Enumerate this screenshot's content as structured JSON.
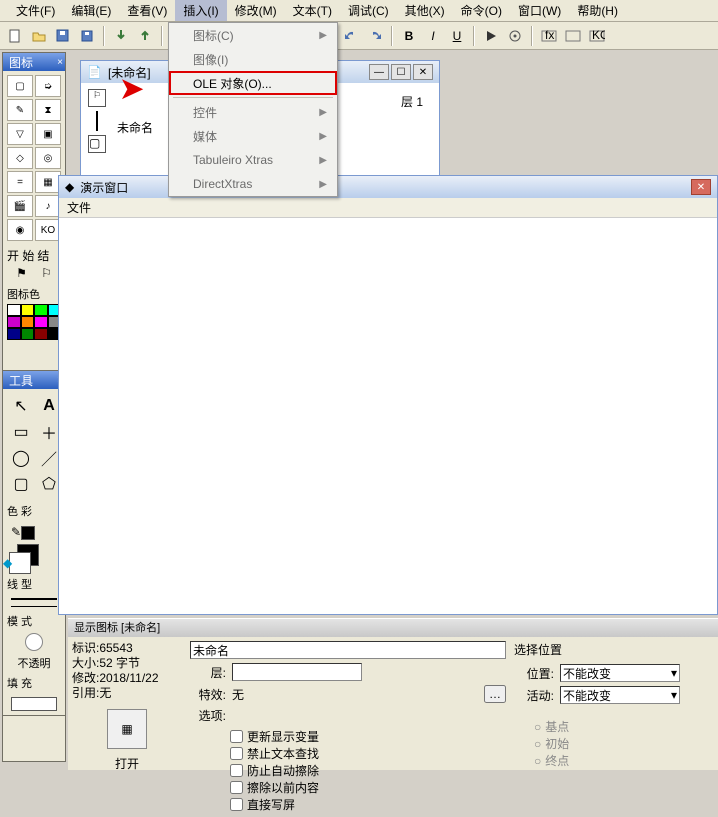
{
  "menu": [
    "文件(F)",
    "编辑(E)",
    "查看(V)",
    "插入(I)",
    "修改(M)",
    "文本(T)",
    "调试(C)",
    "其他(X)",
    "命令(O)",
    "窗口(W)",
    "帮助(H)"
  ],
  "menu_active_index": 3,
  "dropdown": {
    "items": [
      {
        "label": "图标(C)",
        "arrow": true,
        "enabled": false
      },
      {
        "label": "图像(I)",
        "arrow": false,
        "enabled": false
      },
      {
        "label": "OLE 对象(O)...",
        "arrow": false,
        "enabled": true,
        "highlight": true
      },
      {
        "sep": true
      },
      {
        "label": "控件",
        "arrow": true,
        "enabled": false
      },
      {
        "label": "媒体",
        "arrow": true,
        "enabled": false
      },
      {
        "label": "Tabuleiro Xtras",
        "arrow": true,
        "enabled": false
      },
      {
        "label": "DirectXtras",
        "arrow": true,
        "enabled": false
      }
    ]
  },
  "iconpanel_title": "图标",
  "iconpanel_sections": {
    "start": "开 始",
    "end": "结",
    "colors": "图标色"
  },
  "toolpanel_title": "工具",
  "toolpanel_sections": {
    "color": "色 彩",
    "line": "线 型",
    "mode": "模 式",
    "trans": "不透明",
    "fill": "填 充"
  },
  "flowwin": {
    "title": "[未命名]",
    "node": "未命名",
    "layer_label": "层 1"
  },
  "preswin": {
    "title": "演示窗口",
    "menu": "文件"
  },
  "props": {
    "title": "显示图标 [未命名]",
    "left": [
      "标识:65543",
      "大小:52 字节",
      "修改:2018/11/22",
      "引用:无"
    ],
    "open": "打开",
    "name_value": "未命名",
    "layer_label": "层:",
    "effect_label": "特效:",
    "effect_value": "无",
    "options_label": "选项:",
    "options": [
      "更新显示变量",
      "禁止文本查找",
      "防止自动擦除",
      "擦除以前内容",
      "直接写屏"
    ],
    "pos_title": "选择位置",
    "pos_label": "位置:",
    "pos_value": "不能改变",
    "act_label": "活动:",
    "act_value": "不能改变",
    "radios": [
      "基点",
      "初始",
      "终点"
    ]
  },
  "toolbar_fmt": [
    "B",
    "I",
    "U"
  ]
}
